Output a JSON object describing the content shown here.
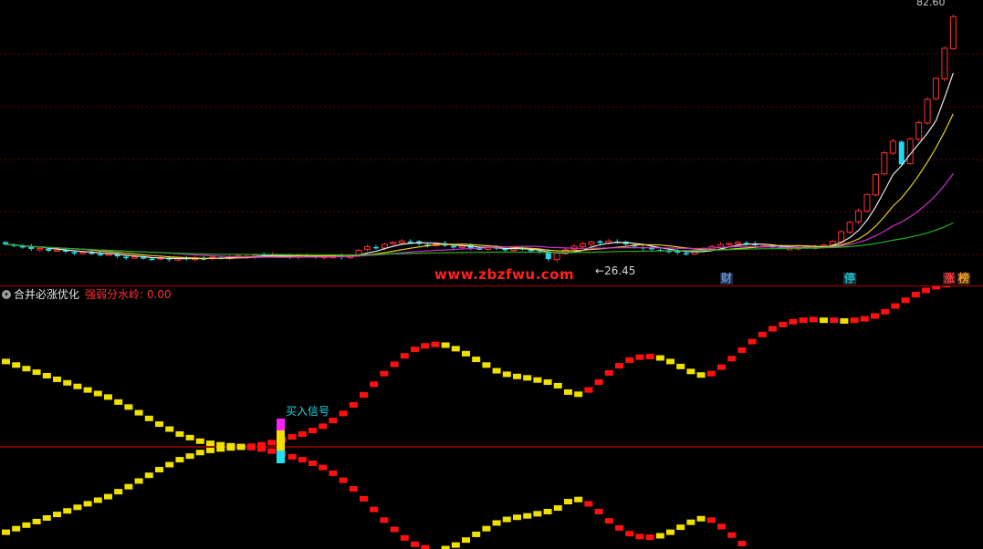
{
  "main_chart": {
    "high_label": "82.60",
    "low_label": "26.45",
    "watermark": "www.zbzfwu.com",
    "events": [
      {
        "text": "财",
        "color": "#6a8ac8",
        "bg": "#1a2a48"
      },
      {
        "text": "停",
        "color": "#20b8c8",
        "bg": "#163a40"
      },
      {
        "text": "涨",
        "color": "#ff4040",
        "bg": "#401616"
      },
      {
        "text": "榜",
        "color": "#f0a020",
        "bg": "#403016"
      }
    ],
    "colors": {
      "up": "#ff3030",
      "down": "#20d8f0",
      "ma5": "#e8e8e8",
      "ma10": "#e8d020",
      "ma20": "#d030d0",
      "ma60": "#20b020",
      "grid": "#6a0000"
    }
  },
  "indicator": {
    "title": "合并必涨优化",
    "param_label": "强弱分水岭: 0.00",
    "buy_signal_label": "买入信号",
    "colors": {
      "rising": "#ff1010",
      "falling": "#f0e000",
      "zero_line": "#c00000",
      "signal_top": "#ff20ff",
      "signal_mid": "#f0e000",
      "signal_bottom": "#20e0f0"
    }
  },
  "chart_data": [
    {
      "type": "candlestick",
      "title": "",
      "ylim": [
        26.45,
        82.6
      ],
      "annotations": [
        "82.60",
        "26.45",
        "www.zbzfwu.com",
        "财",
        "停",
        "涨",
        "榜"
      ],
      "close": [
        30.8,
        30.5,
        30.2,
        29.8,
        29.9,
        29.4,
        29.6,
        29.2,
        28.9,
        29.1,
        28.8,
        28.5,
        28.7,
        28.2,
        27.9,
        28.1,
        27.8,
        27.6,
        27.9,
        27.5,
        27.8,
        27.6,
        27.9,
        27.7,
        28.0,
        27.8,
        28.1,
        28.3,
        28.2,
        28.5,
        28.4,
        28.6,
        28.3,
        28.1,
        28.4,
        28.2,
        28.0,
        28.3,
        28.2,
        28.0,
        28.5,
        29.5,
        30.3,
        30.1,
        30.8,
        31.2,
        31.5,
        31.3,
        30.9,
        30.6,
        30.9,
        30.5,
        30.2,
        30.4,
        30.0,
        29.8,
        30.1,
        29.9,
        29.6,
        29.9,
        29.7,
        29.4,
        29.1,
        27.6,
        28.9,
        29.6,
        30.4,
        30.9,
        31.3,
        31.1,
        31.5,
        31.2,
        30.8,
        30.3,
        30.0,
        29.7,
        29.5,
        29.2,
        29.0,
        28.8,
        29.3,
        29.8,
        30.3,
        30.7,
        31.0,
        31.2,
        30.8,
        30.6,
        30.5,
        30.2,
        30.0,
        29.9,
        30.1,
        30.3,
        30.2,
        30.6,
        31.4,
        33.5,
        35.5,
        38.0,
        41.5,
        45.8,
        50.5,
        53.0,
        48.0,
        53.5,
        57.0,
        62.0,
        66.5,
        73.0,
        79.8
      ]
    },
    {
      "type": "line",
      "title": "合并必涨优化",
      "annotations": [
        "强弱分水岭: 0.00",
        "买入信号"
      ],
      "series": [
        {
          "values": [
            12,
            11.5,
            11,
            10.5,
            10,
            9.5,
            9,
            8.5,
            8,
            7.5,
            7,
            6.3,
            5.6,
            4.8,
            4,
            3.2,
            2.5,
            1.8,
            1.3,
            0.8,
            0.5,
            0.3,
            0.15,
            0.05,
            0.1,
            0.3,
            0.6,
            1,
            1.4,
            1.8,
            2.3,
            2.9,
            3.7,
            4.7,
            5.9,
            7.3,
            8.8,
            10.3,
            11.6,
            12.8,
            13.7,
            14.2,
            14.4,
            14.3,
            13.8,
            13.1,
            12.3,
            11.5,
            10.7,
            10.2,
            9.9,
            9.7,
            9.4,
            9.1,
            8.6,
            7.7,
            7.4,
            8,
            9.1,
            10.4,
            11.4,
            12.2,
            12.6,
            12.7,
            12.5,
            12,
            11.3,
            10.6,
            10.1,
            10.3,
            11.2,
            12.4,
            13.6,
            14.8,
            15.8,
            16.6,
            17.2,
            17.6,
            17.8,
            17.9,
            17.8,
            17.8,
            17.7,
            17.8,
            18,
            18.4,
            19,
            19.8,
            20.6,
            21.4,
            22,
            22.5,
            22.8,
            23,
            23
          ]
        }
      ]
    }
  ]
}
